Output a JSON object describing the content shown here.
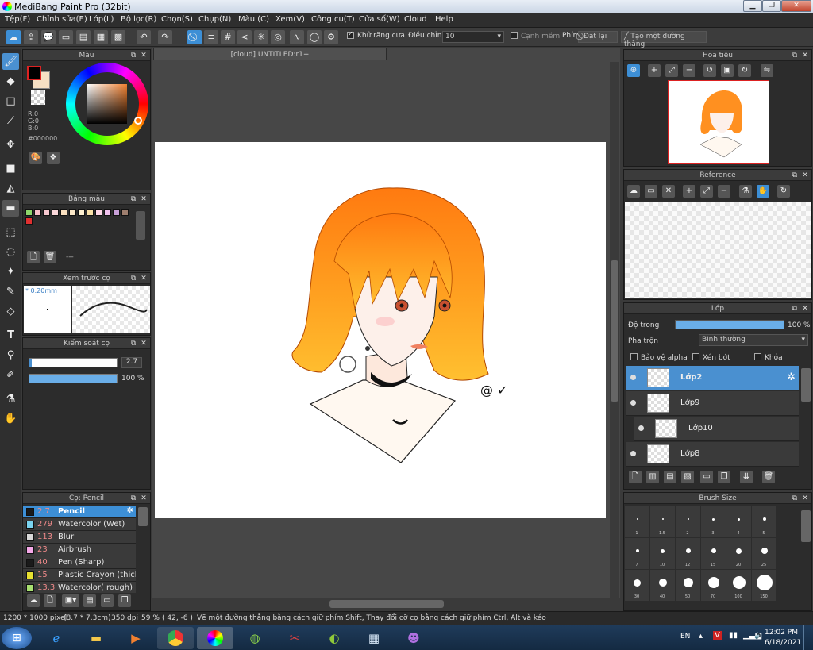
{
  "window": {
    "title": "MediBang Paint Pro (32bit)"
  },
  "menu": [
    "Tệp(F)",
    "Chỉnh sửa(E)",
    "Lớp(L)",
    "Bộ lọc(R)",
    "Chọn(S)",
    "Chụp(N)",
    "Màu (C)",
    "Xem(V)",
    "Công cụ(T)",
    "Cửa số(W)",
    "Cloud",
    "Help"
  ],
  "toolbar": {
    "antialias_label": "Khử răng cưa",
    "adjust_label": "Điều chỉnh",
    "adjust_value": "10",
    "soft_edge_label": "Cạnh mềm",
    "key_label": "Phím",
    "reset_label": "Đặt lại",
    "straight_line_label": "Tạo một đường thẳng"
  },
  "document": {
    "tab_label": "[cloud] UNTITLED:r1+"
  },
  "color_panel": {
    "title": "Màu",
    "r": "R:0",
    "g": "G:0",
    "b": "B:0",
    "hex": "#000000",
    "fg": "#000000",
    "bg": "#f6e0c4"
  },
  "palette_panel": {
    "title": "Bảng màu",
    "colors": [
      "#8ed66b",
      "#f9c0c8",
      "#f7c8cf",
      "#fad7d9",
      "#fbe0c0",
      "#fbe7c8",
      "#fdf0d0",
      "#f8e0a8",
      "#ffd8e8",
      "#f2c2ef",
      "#c8a0d8",
      "#9e7e6e",
      "#e03030"
    ],
    "footer": "---"
  },
  "brush_preview": {
    "title": "Xem trước cọ",
    "size": "* 0.20mm"
  },
  "brush_control": {
    "title": "Kiểm soát cọ",
    "size_value": "2.7",
    "opacity_value": "100 %"
  },
  "brush_list": {
    "title": "Cọ: Pencil",
    "items": [
      {
        "num": "2.7",
        "name": "Pencil",
        "color": "#1a1a1a",
        "selected": true
      },
      {
        "num": "279",
        "name": "Watercolor (Wet)",
        "color": "#7ad4f0"
      },
      {
        "num": "113",
        "name": "Blur",
        "color": "#d8d8d8"
      },
      {
        "num": "23",
        "name": "Airbrush",
        "color": "#f5a8e8"
      },
      {
        "num": "40",
        "name": "Pen (Sharp)",
        "color": "#1a1a1a"
      },
      {
        "num": "15",
        "name": "Plastic Crayon (thick)",
        "color": "#e8e030"
      },
      {
        "num": "13.3",
        "name": "Watercolor( rough)",
        "color": "#a8e070"
      }
    ]
  },
  "navigator": {
    "title": "Hoa tiêu"
  },
  "reference": {
    "title": "Reference"
  },
  "layers_panel": {
    "title": "Lớp",
    "opacity_label": "Độ trong",
    "opacity_value": "100 %",
    "opacity_fraction": 1.0,
    "blend_label": "Pha trộn",
    "blend_value": "Bình thường",
    "protect_alpha": "Bảo vệ alpha",
    "clipping": "Xén bớt",
    "lock": "Khóa",
    "layers": [
      {
        "name": "Lớp2",
        "selected": true
      },
      {
        "name": "Lớp9"
      },
      {
        "name": "Lớp10"
      },
      {
        "name": "Lớp8"
      }
    ]
  },
  "brush_size": {
    "title": "Brush Size",
    "labels": [
      "1",
      "1.5",
      "2",
      "3",
      "4",
      "5",
      "7",
      "10",
      "12",
      "15",
      "20",
      "25",
      "30",
      "40",
      "50",
      "70",
      "100",
      "150"
    ]
  },
  "status": {
    "dimensions": "1200 * 1000 pixel",
    "physical": "(8.7 * 7.3cm)",
    "dpi": "350 dpi",
    "zoom": "59 %",
    "cursor": "( 42, -6 )",
    "hint": "Vẽ một đường thẳng bằng cách giữ phím Shift, Thay đổi cỡ cọ bằng cách giữ phím Ctrl, Alt và kéo"
  },
  "tray": {
    "lang": "EN",
    "time": "12:02 PM",
    "date": "6/18/2021"
  }
}
